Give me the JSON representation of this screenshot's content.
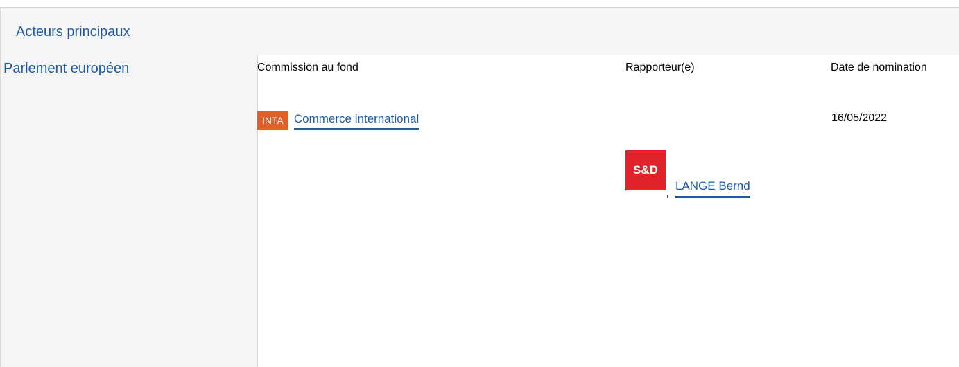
{
  "section": {
    "title": "Acteurs principaux"
  },
  "institution": {
    "name": "Parlement européen"
  },
  "columns": {
    "committee": "Commission au fond",
    "rapporteur": "Rapporteur(e)",
    "date": "Date de nomination"
  },
  "committee": {
    "badge": "INTA",
    "name": "Commerce international",
    "badge_color": "#e06028"
  },
  "rapporteur": {
    "group_logo_text": "S&D",
    "group_logo_color": "#e0232a",
    "name": "LANGE Bernd"
  },
  "nomination_date": "16/05/2022",
  "colors": {
    "link": "#1d5aa6",
    "panel_background": "#f5f5f5"
  }
}
